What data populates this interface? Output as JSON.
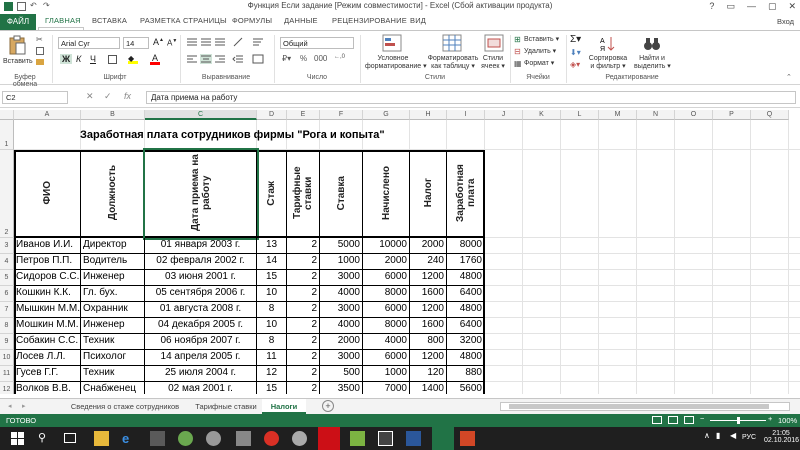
{
  "window": {
    "title": "Функция Если задание  [Режим совместимости] - Excel (Сбой активации продукта)",
    "login": "Вход",
    "controls": [
      "?",
      "▭",
      "—",
      "▢",
      "✕"
    ]
  },
  "ribbon_tabs": [
    "ФАЙЛ",
    "ГЛАВНАЯ",
    "ВСТАВКА",
    "РАЗМЕТКА СТРАНИЦЫ",
    "ФОРМУЛЫ",
    "ДАННЫЕ",
    "РЕЦЕНЗИРОВАНИЕ",
    "ВИД"
  ],
  "ribbon": {
    "paste_label": "Вставить",
    "clipboard_group": "Буфер обмена",
    "font_name": "Arial Cyr",
    "font_size": "14",
    "font_group": "Шрифт",
    "align_group": "Выравнивание",
    "number_format": "Общий",
    "number_group": "Число",
    "cond_format": [
      "Условное",
      "форматирование ▾"
    ],
    "format_table": [
      "Форматировать",
      "как таблицу ▾"
    ],
    "cell_styles": [
      "Стили",
      "ячеек ▾"
    ],
    "styles_group": "Стили",
    "insert": "Вставить ▾",
    "delete": "Удалить ▾",
    "format": "Формат ▾",
    "cells_group": "Ячейки",
    "sort_filter": [
      "Сортировка",
      "и фильтр ▾"
    ],
    "find_select": [
      "Найти и",
      "выделить ▾"
    ],
    "editing_group": "Редактирование",
    "bold": "Ж",
    "italic": "К",
    "underline": "Ч"
  },
  "formula_bar": {
    "name_box": "C2",
    "fx": "fx",
    "content": "Дата приема на работу"
  },
  "columns": [
    "A",
    "B",
    "C",
    "D",
    "E",
    "F",
    "G",
    "H",
    "I",
    "J",
    "K",
    "L",
    "M",
    "N",
    "O",
    "P",
    "Q"
  ],
  "rows": [
    "1",
    "2",
    "3",
    "4",
    "5",
    "6",
    "7",
    "8",
    "9",
    "10",
    "11",
    "12",
    "13",
    "14",
    "15",
    "16"
  ],
  "sheet": {
    "title": "Заработная плата сотрудников фирмы \"Рога и копыта\"",
    "headers": [
      "ФИО",
      "Должность",
      "Дата приема на работу",
      "Стаж",
      "Тарифные ставки",
      "Ставка",
      "Начислено",
      "Налог",
      "Заработная плата"
    ],
    "records": [
      [
        "Иванов И.И.",
        "Директор",
        "01 января 2003 г.",
        "13",
        "2",
        "5000",
        "10000",
        "2000",
        "8000"
      ],
      [
        "Петров П.П.",
        "Водитель",
        "02 февраля 2002 г.",
        "14",
        "2",
        "1000",
        "2000",
        "240",
        "1760"
      ],
      [
        "Сидоров С.С.",
        "Инженер",
        "03 июня 2001 г.",
        "15",
        "2",
        "3000",
        "6000",
        "1200",
        "4800"
      ],
      [
        "Кошкин К.К.",
        "Гл. бух.",
        "05 сентября 2006 г.",
        "10",
        "2",
        "4000",
        "8000",
        "1600",
        "6400"
      ],
      [
        "Мышкин М.М.",
        "Охранник",
        "01 августа 2008 г.",
        "8",
        "2",
        "3000",
        "6000",
        "1200",
        "4800"
      ],
      [
        "Мошкин М.М.",
        "Инженер",
        "04 декабря 2005 г.",
        "10",
        "2",
        "4000",
        "8000",
        "1600",
        "6400"
      ],
      [
        "Собакин С.С.",
        "Техник",
        "06 ноября 2007 г.",
        "8",
        "2",
        "2000",
        "4000",
        "800",
        "3200"
      ],
      [
        "Лосев Л.Л.",
        "Психолог",
        "14 апреля 2005 г.",
        "11",
        "2",
        "3000",
        "6000",
        "1200",
        "4800"
      ],
      [
        "Гусев Г.Г.",
        "Техник",
        "25 июля 2004 г.",
        "12",
        "2",
        "500",
        "1000",
        "120",
        "880"
      ],
      [
        "Волков В.В.",
        "Снабженец",
        "02 мая 2001 г.",
        "15",
        "2",
        "3500",
        "7000",
        "1400",
        "5600"
      ]
    ]
  },
  "sheet_tabs": [
    "Сведения о стаже сотрудников",
    "Тарифные ставки",
    "Налоги"
  ],
  "active_sheet": "Налоги",
  "status": {
    "ready": "ГОТОВО",
    "zoom": "100%",
    "zoom_minus": "−",
    "zoom_plus": "+"
  },
  "taskbar": {
    "lang": "РУС",
    "time": "21:05",
    "date": "02.10.2016"
  },
  "colors": {
    "excel_green": "#217346",
    "taskbar": "#1f1f1f"
  }
}
